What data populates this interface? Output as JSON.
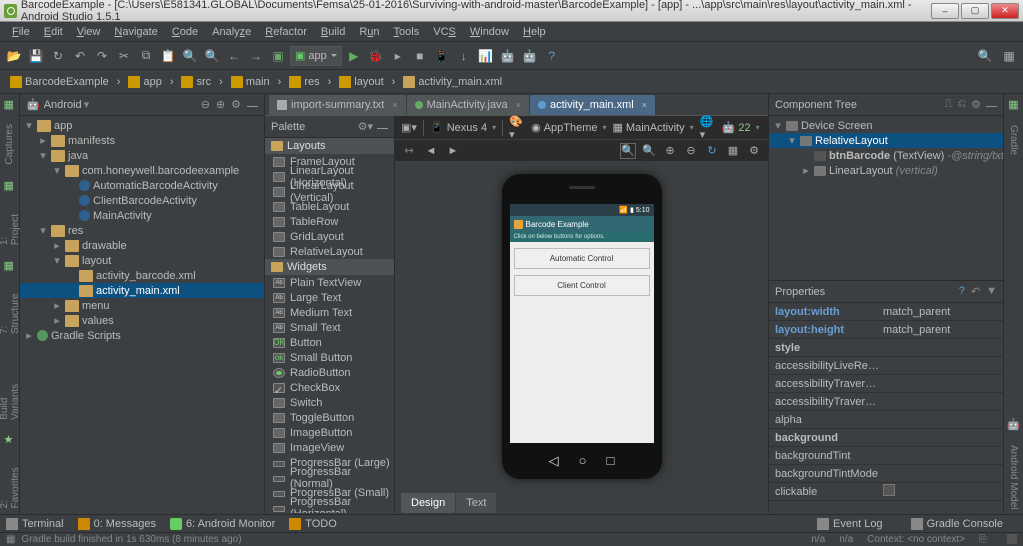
{
  "title": "BarcodeExample - [C:\\Users\\E581341.GLOBAL\\Documents\\Femsa\\25-01-2016\\Surviving-with-android-master\\BarcodeExample] - [app] - ...\\app\\src\\main\\res\\layout\\activity_main.xml - Android Studio 1.5.1",
  "menus": [
    "File",
    "Edit",
    "View",
    "Navigate",
    "Code",
    "Analyze",
    "Refactor",
    "Build",
    "Run",
    "Tools",
    "VCS",
    "Window",
    "Help"
  ],
  "run_config": "app",
  "breadcrumbs": [
    {
      "icon": "folder",
      "label": "BarcodeExample"
    },
    {
      "icon": "folder",
      "label": "app"
    },
    {
      "icon": "folder",
      "label": "src"
    },
    {
      "icon": "folder",
      "label": "main"
    },
    {
      "icon": "folder",
      "label": "res"
    },
    {
      "icon": "folder",
      "label": "layout"
    },
    {
      "icon": "xml",
      "label": "activity_main.xml"
    }
  ],
  "project_view": "Android",
  "tree": {
    "root": "app",
    "manifests": "manifests",
    "java": "java",
    "package": "com.honeywell.barcodeexample",
    "classes": [
      "AutomaticBarcodeActivity",
      "ClientBarcodeActivity",
      "MainActivity"
    ],
    "res": "res",
    "res_children": {
      "drawable": "drawable",
      "layout": "layout"
    },
    "layout_files": [
      "activity_barcode.xml",
      "activity_main.xml"
    ],
    "menu": "menu",
    "values": "values",
    "gradle": "Gradle Scripts"
  },
  "editor_tabs": [
    {
      "label": "import-summary.txt",
      "kind": "file"
    },
    {
      "label": "MainActivity.java",
      "kind": "green"
    },
    {
      "label": "activity_main.xml",
      "kind": "blue",
      "active": true
    }
  ],
  "palette": {
    "title": "Palette",
    "groups": [
      "Layouts",
      "Widgets"
    ],
    "layouts": [
      "FrameLayout",
      "LinearLayout (Horizontal)",
      "LinearLayout (Vertical)",
      "TableLayout",
      "TableRow",
      "GridLayout",
      "RelativeLayout"
    ],
    "widgets": [
      "Plain TextView",
      "Large Text",
      "Medium Text",
      "Small Text",
      "Button",
      "Small Button",
      "RadioButton",
      "CheckBox",
      "Switch",
      "ToggleButton",
      "ImageButton",
      "ImageView",
      "ProgressBar (Large)",
      "ProgressBar (Normal)",
      "ProgressBar (Small)",
      "ProgressBar (Horizontal)"
    ]
  },
  "preview_toolbar": {
    "device": "Nexus 4",
    "theme": "AppTheme",
    "context": "MainActivity",
    "api": "22"
  },
  "preview_app": {
    "time": "5:10",
    "title": "Barcode Example",
    "instruction": "Click on below buttons for options.",
    "btn1": "Automatic Control",
    "btn2": "Client Control"
  },
  "design_tabs": [
    "Design",
    "Text"
  ],
  "component_tree": {
    "title": "Component Tree",
    "root": "Device Screen",
    "rl": "RelativeLayout",
    "child1": {
      "name": "btnBarcode",
      "type": "(TextView)",
      "value": "@string/txtMainTit"
    },
    "child2": {
      "name": "LinearLayout",
      "desc": "(vertical)"
    }
  },
  "properties": {
    "title": "Properties",
    "rows": [
      {
        "k": "layout:width",
        "v": "match_parent",
        "link": true,
        "bold": true
      },
      {
        "k": "layout:height",
        "v": "match_parent",
        "link": true,
        "bold": true
      },
      {
        "k": "style",
        "v": "",
        "bold": true
      },
      {
        "k": "accessibilityLiveRegion",
        "v": ""
      },
      {
        "k": "accessibilityTraversalAfte",
        "v": ""
      },
      {
        "k": "accessibilityTraversalBefo",
        "v": ""
      },
      {
        "k": "alpha",
        "v": ""
      },
      {
        "k": "background",
        "v": "",
        "bold": true
      },
      {
        "k": "backgroundTint",
        "v": ""
      },
      {
        "k": "backgroundTintMode",
        "v": ""
      },
      {
        "k": "clickable",
        "v": "",
        "checkbox": true
      }
    ]
  },
  "bottom_tools": [
    "Terminal",
    "0: Messages",
    "6: Android Monitor",
    "TODO"
  ],
  "bottom_right": [
    "Event Log",
    "Gradle Console"
  ],
  "status_msg": "Gradle build finished in 1s 630ms (8 minutes ago)",
  "status_right": {
    "a": "n/a",
    "b": "n/a",
    "c": "Context: <no context>"
  }
}
